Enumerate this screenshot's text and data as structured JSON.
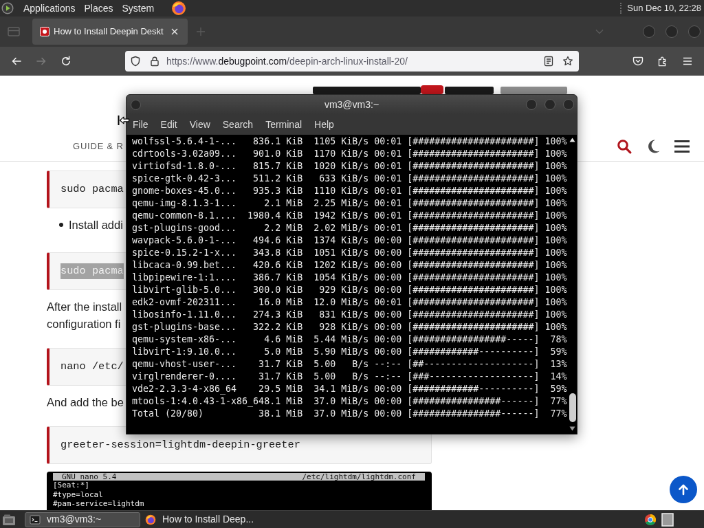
{
  "top_panel": {
    "menus": [
      "Applications",
      "Places",
      "System"
    ],
    "clock": "Sun Dec 10, 22:28"
  },
  "browser": {
    "tabs": [
      {
        "title": "How to Install Deepin Deskt",
        "selected": true
      }
    ],
    "nav_buttons": [
      {
        "kind": "back",
        "disabled": false
      },
      {
        "kind": "forward",
        "disabled": true
      },
      {
        "kind": "reload",
        "disabled": false
      }
    ],
    "url": "https://www.**debugpoint.com**/deepin-arch-linux-install-20/"
  },
  "page": {
    "nav_label": "GUIDE & R",
    "blocks": [
      {
        "kind": "code",
        "text": "sudo pacma",
        "highlighted": false
      },
      {
        "kind": "bullet",
        "text": "Install addi"
      },
      {
        "kind": "code",
        "text": "sudo pacma",
        "highlighted": true
      },
      {
        "kind": "paragraph",
        "lines": [
          "After the install",
          "configuration fi"
        ]
      },
      {
        "kind": "code",
        "text": "nano /etc/",
        "highlighted": false
      },
      {
        "kind": "paragraph",
        "lines": [
          "And add the be"
        ]
      },
      {
        "kind": "code",
        "text": "greeter-session=lightdm-deepin-greeter",
        "highlighted": false
      },
      {
        "kind": "screenshot",
        "title": "GNU nano 5.4",
        "path": "/etc/lightdm/lightdm.conf",
        "lines": [
          "[Seat:*]",
          "#type=local",
          "#pam-service=lightdm"
        ]
      }
    ]
  },
  "terminal": {
    "title": "vm3@vm3:~",
    "menu": [
      "File",
      "Edit",
      "View",
      "Search",
      "Terminal",
      "Help"
    ],
    "lines": [
      "wolfssl-5.6.4-1-...   836.1 KiB  1105 KiB/s 00:01 [######################] 100%",
      "cdrtools-3.02a09...   901.0 KiB  1170 KiB/s 00:01 [######################] 100%",
      "virtiofsd-1.8.0-...   815.7 KiB  1020 KiB/s 00:01 [######################] 100%",
      "spice-gtk-0.42-3...   511.2 KiB   633 KiB/s 00:01 [######################] 100%",
      "gnome-boxes-45.0...   935.3 KiB  1110 KiB/s 00:01 [######################] 100%",
      "qemu-img-8.1.3-1...     2.1 MiB  2.25 MiB/s 00:01 [######################] 100%",
      "qemu-common-8.1....  1980.4 KiB  1942 KiB/s 00:01 [######################] 100%",
      "gst-plugins-good...     2.2 MiB  2.02 MiB/s 00:01 [######################] 100%",
      "wavpack-5.6.0-1-...   494.6 KiB  1374 KiB/s 00:00 [######################] 100%",
      "spice-0.15.2-1-x...   343.8 KiB  1051 KiB/s 00:00 [######################] 100%",
      "libcaca-0.99.bet...   420.6 KiB  1202 KiB/s 00:00 [######################] 100%",
      "libpipewire-1:1....   386.7 KiB  1054 KiB/s 00:00 [######################] 100%",
      "libvirt-glib-5.0...   300.0 KiB   929 KiB/s 00:00 [######################] 100%",
      "edk2-ovmf-202311...    16.0 MiB  12.0 MiB/s 00:01 [######################] 100%",
      "libosinfo-1.11.0...   274.3 KiB   831 KiB/s 00:00 [######################] 100%",
      "gst-plugins-base...   322.2 KiB   928 KiB/s 00:00 [######################] 100%",
      "qemu-system-x86-...     4.6 MiB  5.44 MiB/s 00:00 [#################-----]  78%",
      "libvirt-1:9.10.0...     5.0 MiB  5.90 MiB/s 00:00 [############----------]  59%",
      "qemu-vhost-user-...    31.7 KiB  5.00   B/s --:-- [##--------------------]  13%",
      "virglrenderer-0....    31.7 KiB  5.00   B/s --:-- [###-------------------]  14%",
      "vde2-2.3.3-4-x86_64    29.5 MiB  34.1 MiB/s 00:00 [############----------]  59%",
      "mtools-1:4.0.43-1-x86_648.1 MiB  37.0 MiB/s 00:00 [################------]  77%",
      "Total (20/80)          38.1 MiB  37.0 MiB/s 00:00 [################------]  77%"
    ]
  },
  "taskbar": {
    "items": [
      {
        "kind": "terminal",
        "label": "vm3@vm3:~",
        "selected": true
      },
      {
        "kind": "browser",
        "label": "How to Install Deep...",
        "selected": false
      }
    ]
  }
}
